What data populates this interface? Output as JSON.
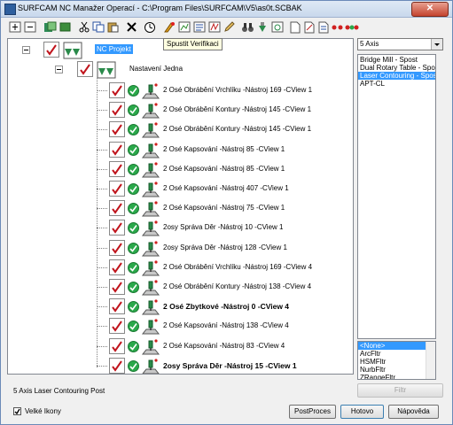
{
  "window": {
    "title": "SURFCAM NC Manažer Operací - C:\\Program Files\\SURFCAM\\V5\\as0t.SCBAK",
    "close_symbol": "✕"
  },
  "toolbar": {
    "tooltip": "Spustit Verifikaci"
  },
  "tree": {
    "project_label": "NC Projekt",
    "setup_label": "Nastavení Jedna",
    "operations": [
      {
        "label": "2 Osé Obrábění Vrchlíku  -Nástroj 169 -CView 1",
        "bold": false
      },
      {
        "label": "2 Osé Obrábění Kontury  -Nástroj 145 -CView 1",
        "bold": false
      },
      {
        "label": "2 Osé Obrábění Kontury  -Nástroj 145 -CView 1",
        "bold": false
      },
      {
        "label": "2 Osé Kapsování  -Nástroj 85 -CView 1",
        "bold": false
      },
      {
        "label": "2 Osé Kapsování  -Nástroj 85 -CView 1",
        "bold": false
      },
      {
        "label": "2 Osé Kapsování  -Nástroj 407 -CView 1",
        "bold": false
      },
      {
        "label": "2 Osé Kapsování  -Nástroj 75 -CView 1",
        "bold": false
      },
      {
        "label": "2osy Správa Děr  -Nástroj 10 -CView 1",
        "bold": false
      },
      {
        "label": "2osy Správa Děr  -Nástroj 128 -CView 1",
        "bold": false
      },
      {
        "label": "2 Osé Obrábění Vrchlíku  -Nástroj 169 -CView 4",
        "bold": false
      },
      {
        "label": "2 Osé Obrábění Kontury  -Nástroj 138 -CView 4",
        "bold": false
      },
      {
        "label": "2 Osé Zbytkové  -Nástroj 0 -CView 4",
        "bold": true
      },
      {
        "label": "2 Osé Kapsování  -Nástroj 138 -CView 4",
        "bold": false
      },
      {
        "label": "2 Osé Kapsování  -Nástroj 83 -CView 4",
        "bold": false
      },
      {
        "label": "2osy Správa Děr  -Nástroj 15 -CView 1",
        "bold": true
      }
    ]
  },
  "post_select": {
    "value": "5 Axis",
    "options": [
      "Bridge Mill - Spost",
      "Dual Rotary Table - Spost",
      "Laser Contouring - Spost",
      "APT-CL"
    ],
    "selected_index": 2
  },
  "filter_list": {
    "options": [
      "<None>",
      "ArcFltr",
      "HSMFltr",
      "NurbFltr",
      "ZRangeFltr"
    ],
    "selected_index": 0
  },
  "buttons": {
    "filtr": "Filtr",
    "postproces": "PostProces",
    "hotovo": "Hotovo",
    "napoveda": "Nápověda"
  },
  "status_text": "5 Axis Laser Contouring Post",
  "large_icons": {
    "label": "Velké Ikony",
    "checked": true
  },
  "colors": {
    "selection": "#3399ff",
    "check_red": "#c0141c",
    "ok_green": "#2aa84a"
  }
}
